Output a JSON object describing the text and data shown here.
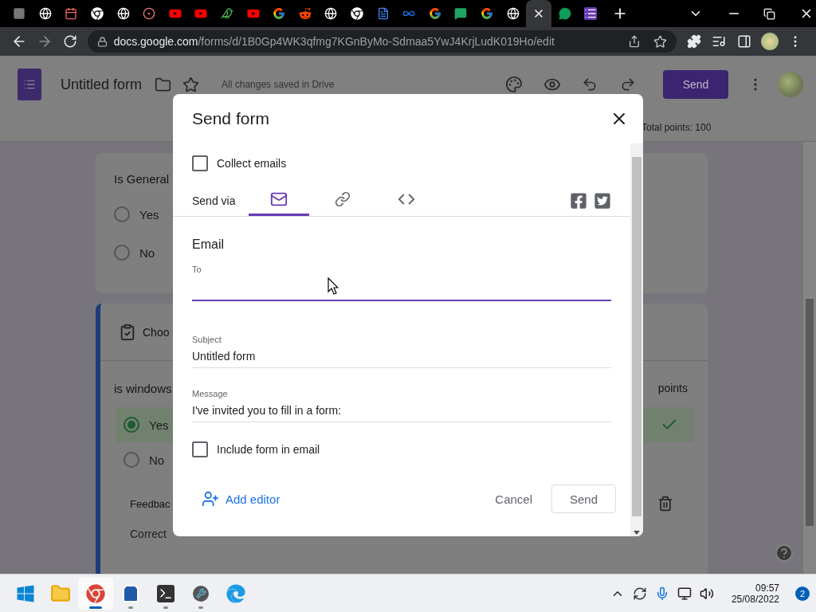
{
  "browser": {
    "tabs": [
      {
        "kind": "square",
        "selected": false
      },
      {
        "kind": "globe",
        "selected": false
      },
      {
        "kind": "calendar",
        "selected": false
      },
      {
        "kind": "chrome",
        "selected": false
      },
      {
        "kind": "globe",
        "selected": false
      },
      {
        "kind": "record",
        "selected": false
      },
      {
        "kind": "video",
        "selected": false
      },
      {
        "kind": "video",
        "selected": false
      },
      {
        "kind": "bird",
        "selected": false
      },
      {
        "kind": "video",
        "selected": false
      },
      {
        "kind": "google",
        "selected": false
      },
      {
        "kind": "alien",
        "selected": false
      },
      {
        "kind": "globe",
        "selected": false
      },
      {
        "kind": "chrome",
        "selected": false
      },
      {
        "kind": "doc",
        "selected": false
      },
      {
        "kind": "infinity",
        "selected": false
      },
      {
        "kind": "google",
        "selected": false
      },
      {
        "kind": "chat",
        "selected": false
      },
      {
        "kind": "google",
        "selected": false
      },
      {
        "kind": "globe",
        "selected": false
      },
      {
        "kind": "close",
        "selected": true
      },
      {
        "kind": "hangouts",
        "selected": false
      },
      {
        "kind": "list",
        "selected": false
      }
    ],
    "url_host": "docs.google.com",
    "url_path": "/forms/d/1B0Gp4WK3qfmg7KGnByMo-Sdmaa5YwJ4KrjLudK019Ho/edit"
  },
  "header": {
    "title": "Untitled form",
    "save_status": "All changes saved in Drive",
    "send_button": "Send",
    "total_points": "Total points: 100"
  },
  "cards": [
    {
      "active": false,
      "question": "Is General",
      "options": [
        {
          "label": "Yes",
          "selected": false,
          "correct": false
        },
        {
          "label": "No",
          "selected": false,
          "correct": false
        }
      ]
    },
    {
      "active": true,
      "type_label": "Choo",
      "question": "is windows",
      "points_label": "points",
      "options": [
        {
          "label": "Yes",
          "selected": true,
          "correct": true
        },
        {
          "label": "No",
          "selected": false,
          "correct": false
        }
      ],
      "feedback_label": "Feedbac",
      "feedback_value": "Correct"
    }
  ],
  "dialog": {
    "title": "Send form",
    "collect_emails": {
      "label": "Collect emails",
      "checked": false
    },
    "send_via_label": "Send via",
    "methods": [
      {
        "kind": "email",
        "selected": true
      },
      {
        "kind": "link",
        "selected": false
      },
      {
        "kind": "embed",
        "selected": false
      }
    ],
    "share": [
      {
        "kind": "facebook"
      },
      {
        "kind": "twitter"
      }
    ],
    "section_title": "Email",
    "to": {
      "label": "To",
      "focused": true
    },
    "subject": {
      "label": "Subject",
      "value": "Untitled form"
    },
    "message": {
      "label": "Message",
      "value": "I've invited you to fill in a form:"
    },
    "include_form": {
      "label": "Include form in email",
      "checked": false
    },
    "add_editor": "Add editor",
    "cancel": "Cancel",
    "send": "Send"
  },
  "taskbar": {
    "apps": [
      {
        "kind": "start",
        "selected": false,
        "running": false
      },
      {
        "kind": "explorer",
        "selected": false,
        "running": false
      },
      {
        "kind": "chrome",
        "selected": true,
        "running": true
      },
      {
        "kind": "store",
        "selected": false,
        "running": true
      },
      {
        "kind": "terminal",
        "selected": false,
        "running": true
      },
      {
        "kind": "tool",
        "selected": false,
        "running": true
      },
      {
        "kind": "edge",
        "selected": false,
        "running": false
      }
    ],
    "time": "09:57",
    "date": "25/08/2022",
    "notifications": "2"
  }
}
